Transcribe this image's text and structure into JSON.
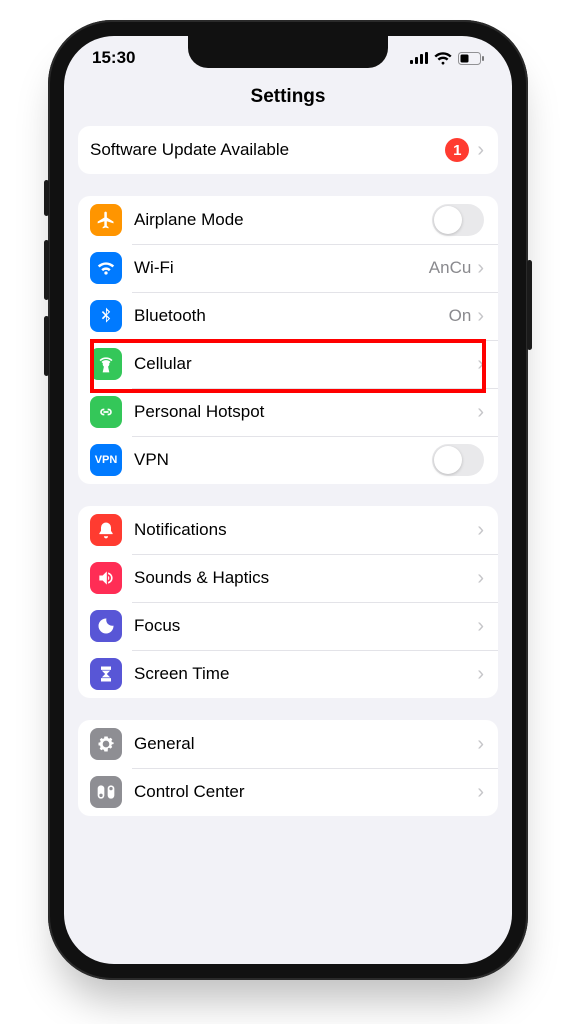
{
  "status": {
    "time": "15:30"
  },
  "title": "Settings",
  "groups": {
    "update": {
      "label": "Software Update Available",
      "badge": "1"
    },
    "net": {
      "airplane": "Airplane Mode",
      "wifi": {
        "label": "Wi-Fi",
        "value": "AnCu"
      },
      "bluetooth": {
        "label": "Bluetooth",
        "value": "On"
      },
      "cellular": "Cellular",
      "hotspot": "Personal Hotspot",
      "vpn": "VPN"
    },
    "notif": {
      "notifications": "Notifications",
      "sounds": "Sounds & Haptics",
      "focus": "Focus",
      "screentime": "Screen Time"
    },
    "gen": {
      "general": "General",
      "control": "Control Center"
    }
  },
  "colors": {
    "orange": "#ff9500",
    "blue": "#007aff",
    "green": "#34c759",
    "red": "#ff3b30",
    "indigo": "#5856d6",
    "gray": "#8e8e93",
    "pink": "#ff2d55"
  }
}
